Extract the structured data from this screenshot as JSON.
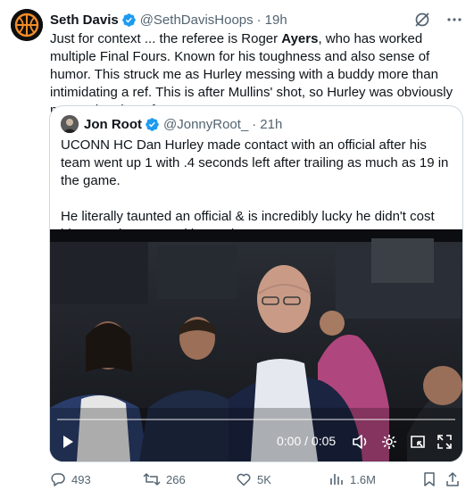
{
  "author": {
    "name": "Seth Davis",
    "handle": "@SethDavisHoops",
    "separator": "·",
    "time": "19h"
  },
  "tweet": {
    "line1_pre": "Just for context ... the referee is Roger ",
    "line1_bold": "Ayers",
    "line1_post": ", who has worked multiple Final Fours. Known for his toughness and also sense of humor. This struck me as Hurley messing with a buddy more than intimidating a ref. This is after Mullins' shot, so Hurley was obviously not mad at the refs."
  },
  "quote": {
    "name": "Jon Root",
    "handle": "@JonnyRoot_",
    "separator": "·",
    "time": "21h",
    "paragraph1": "UCONN HC Dan Hurley made contact with an official after his team went up 1 with .4 seconds left after trailing as much as 19 in the game.",
    "paragraph2": "He literally taunted an official & is incredibly lucky he didn't cost his team the game with a tech."
  },
  "video": {
    "time_display": "0:00 / 0:05",
    "progress": 0
  },
  "actions": {
    "replies": "493",
    "reposts": "266",
    "likes": "5K",
    "views": "1.6M"
  },
  "colors": {
    "verified": "#1d9bf0",
    "secondary_text": "#536471",
    "border": "#cfd9de",
    "avatar_accent": "#f28c28"
  },
  "icons": [
    "grok-icon",
    "more-icon",
    "verified-badge-icon",
    "play-icon",
    "volume-icon",
    "settings-icon",
    "pip-icon",
    "fullscreen-icon",
    "reply-icon",
    "repost-icon",
    "like-icon",
    "views-icon",
    "bookmark-icon",
    "share-icon"
  ]
}
